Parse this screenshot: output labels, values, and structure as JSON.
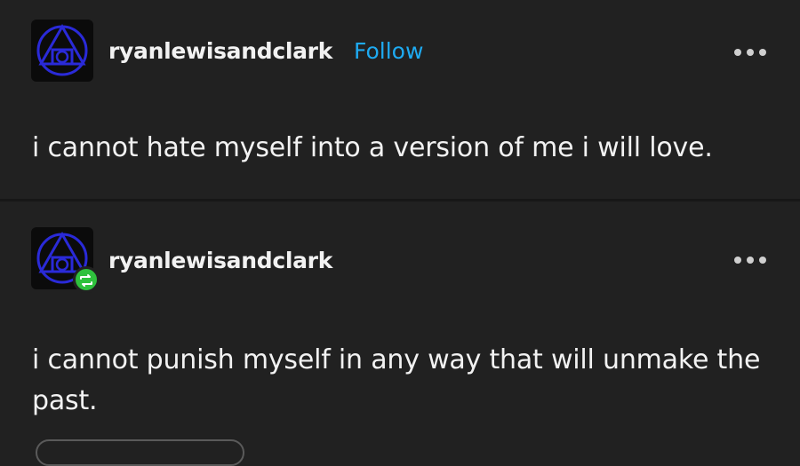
{
  "posts": [
    {
      "username": "ryanlewisandclark",
      "follow_label": "Follow",
      "avatar_icon": "alchemy-triangle-circle-avatar",
      "body": "i cannot hate myself into a version of me i will love."
    },
    {
      "username": "ryanlewisandclark",
      "avatar_icon": "alchemy-triangle-circle-avatar",
      "badge_icon": "reblog-icon",
      "body": "i cannot punish myself in any way that will unmake the past."
    }
  ],
  "colors": {
    "background": "#212121",
    "text": "#f2f2f2",
    "follow": "#1eaaf1",
    "reblog_badge": "#2fc13d",
    "avatar_line": "#2a2ad8"
  }
}
